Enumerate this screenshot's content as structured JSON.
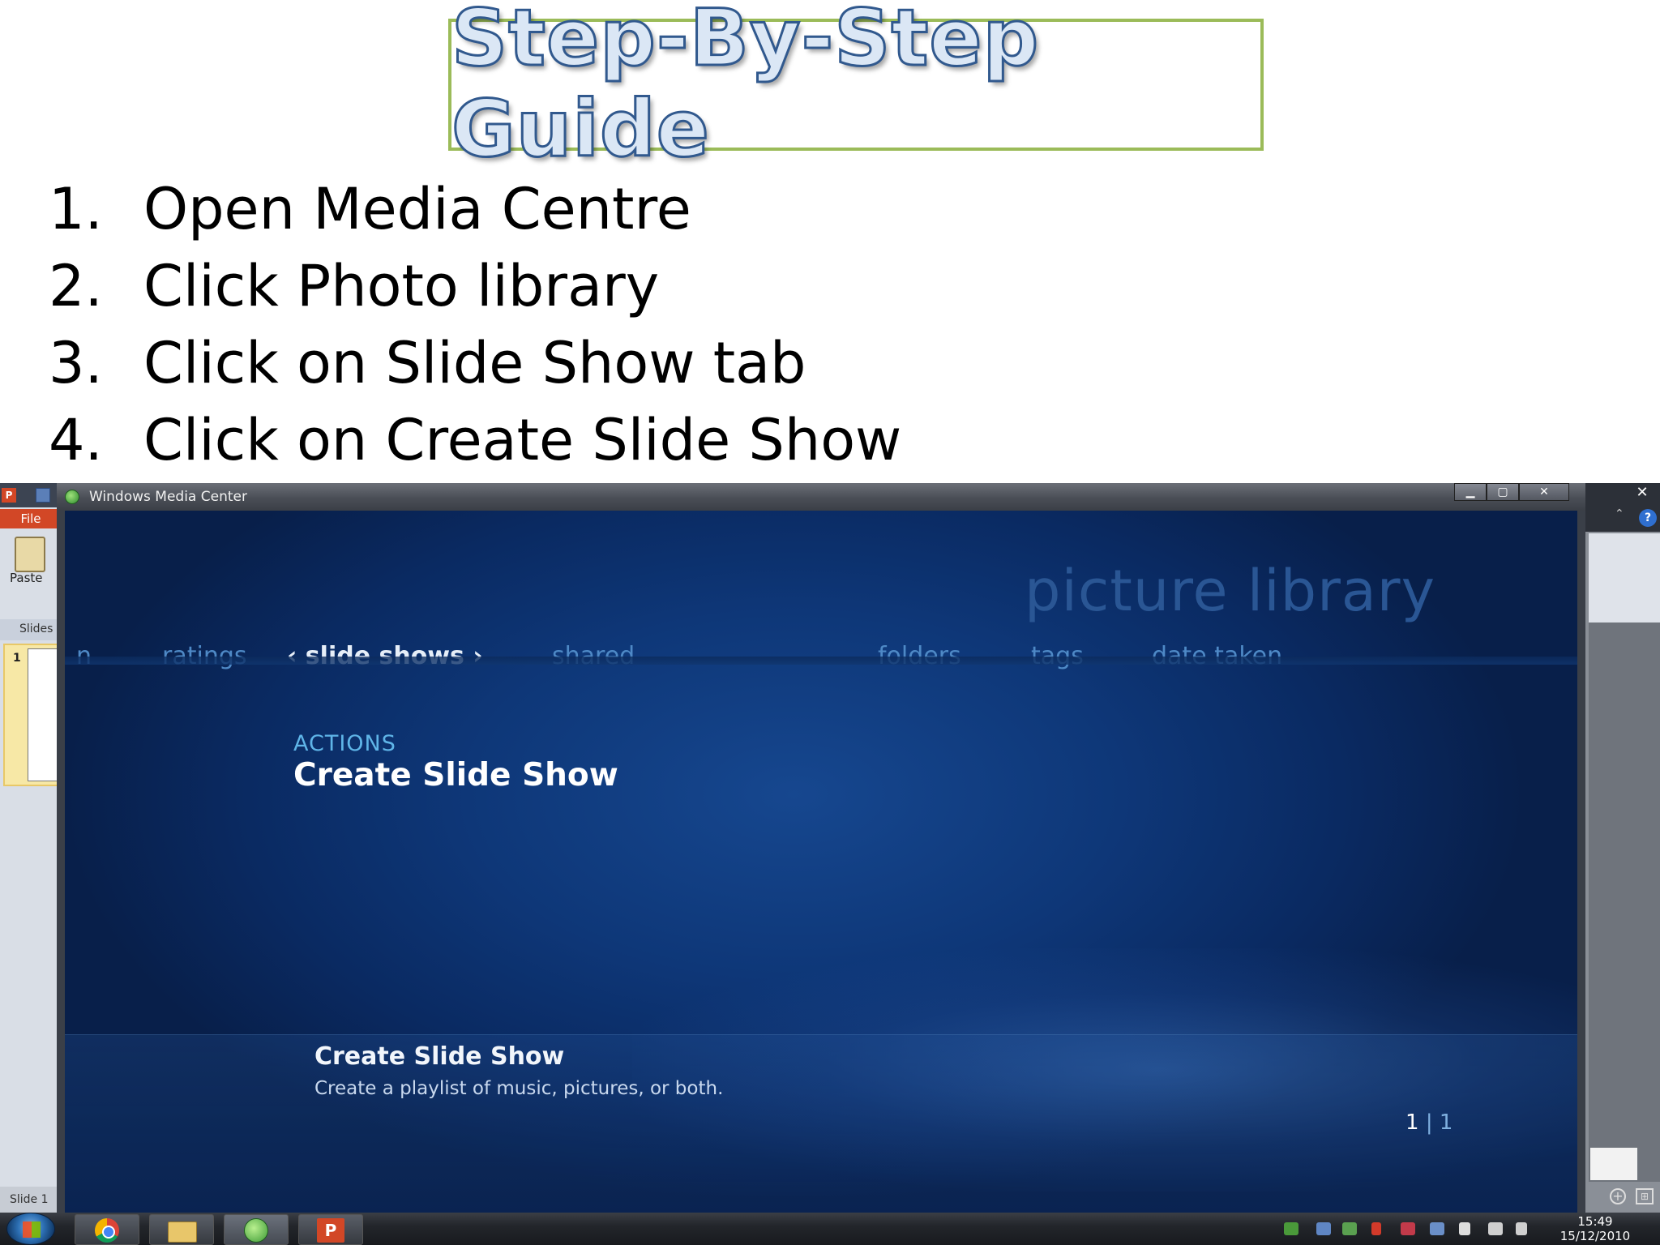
{
  "slide": {
    "title": "Step-By-Step Guide",
    "steps": [
      {
        "num": "1.",
        "text": "Open Media Centre"
      },
      {
        "num": "2.",
        "text": "Click Photo library"
      },
      {
        "num": "3.",
        "text": "Click on Slide Show tab"
      },
      {
        "num": "4.",
        "text": "Click on Create Slide Show"
      }
    ]
  },
  "powerpoint": {
    "file_tab": "File",
    "paste_label": "Paste",
    "slides_tab": "Slides",
    "thumb_number": "1",
    "status": "Slide 1",
    "close_glyph": "✕",
    "help_glyph": "?"
  },
  "wmc": {
    "window_title": "Windows Media Center",
    "heading": "picture library",
    "nav": {
      "partial": "n",
      "ratings": "ratings",
      "slide_shows": "‹ slide shows ›",
      "shared": "shared",
      "folders": "folders",
      "tags": "tags",
      "date_taken": "date taken"
    },
    "actions_label": "ACTIONS",
    "action_item": "Create Slide Show",
    "detail_title": "Create Slide Show",
    "detail_desc": "Create a playlist of music, pictures, or both.",
    "pager_current": "1",
    "pager_sep": "|",
    "pager_total": "1"
  },
  "taskbar": {
    "ppt_glyph": "P",
    "time": "15:49",
    "date": "15/12/2010"
  }
}
